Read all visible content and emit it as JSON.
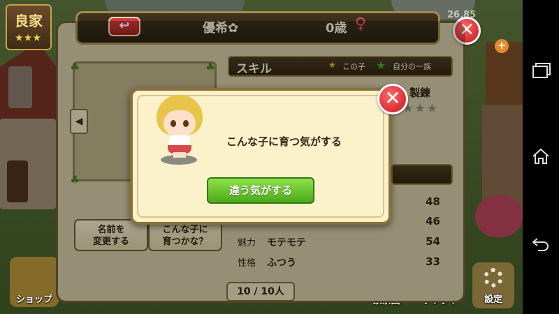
{
  "hud": {
    "family_rank": "良家",
    "rank_stars": "★★★",
    "top_number": "26,85",
    "shop_label": "ショップ",
    "family_tree_label": "家系図",
    "friend_label": "フレンド",
    "settings_label": "設定",
    "plus_symbol": "+"
  },
  "profile": {
    "back_symbol": "↩",
    "name": "優希✿",
    "age": "0歳",
    "gender_symbol": "♀",
    "close_symbol": "✕",
    "nav_left_symbol": "◀",
    "skill": {
      "title": "スキル",
      "legend_own_label": "この子",
      "legend_family_label": "自分の一族",
      "visible_skill_name": "製錬",
      "stars": "★★★",
      "stars_filled": 0,
      "stars_total": 3
    },
    "stats": [
      {
        "label": "",
        "value_text": "",
        "number": "48"
      },
      {
        "label": "",
        "value_text": "",
        "number": "46"
      },
      {
        "label": "魅力",
        "value_text": "モテモテ",
        "number": "54"
      },
      {
        "label": "性格",
        "value_text": "ふつう",
        "number": "33"
      }
    ],
    "rename_button": [
      "名前を",
      "変更する"
    ],
    "grow_button": [
      "こんな子に",
      "育つかな？"
    ],
    "pager": "10 / 10人"
  },
  "modal": {
    "message": "こんな子に育つ気がする",
    "button_label": "違う気がする",
    "close_symbol": "✕"
  },
  "colors": {
    "accent_red": "#c8141c",
    "accent_green": "#4caa1a",
    "panel_bg": "#cfc8a2",
    "modal_bg": "#fbf2cc"
  }
}
